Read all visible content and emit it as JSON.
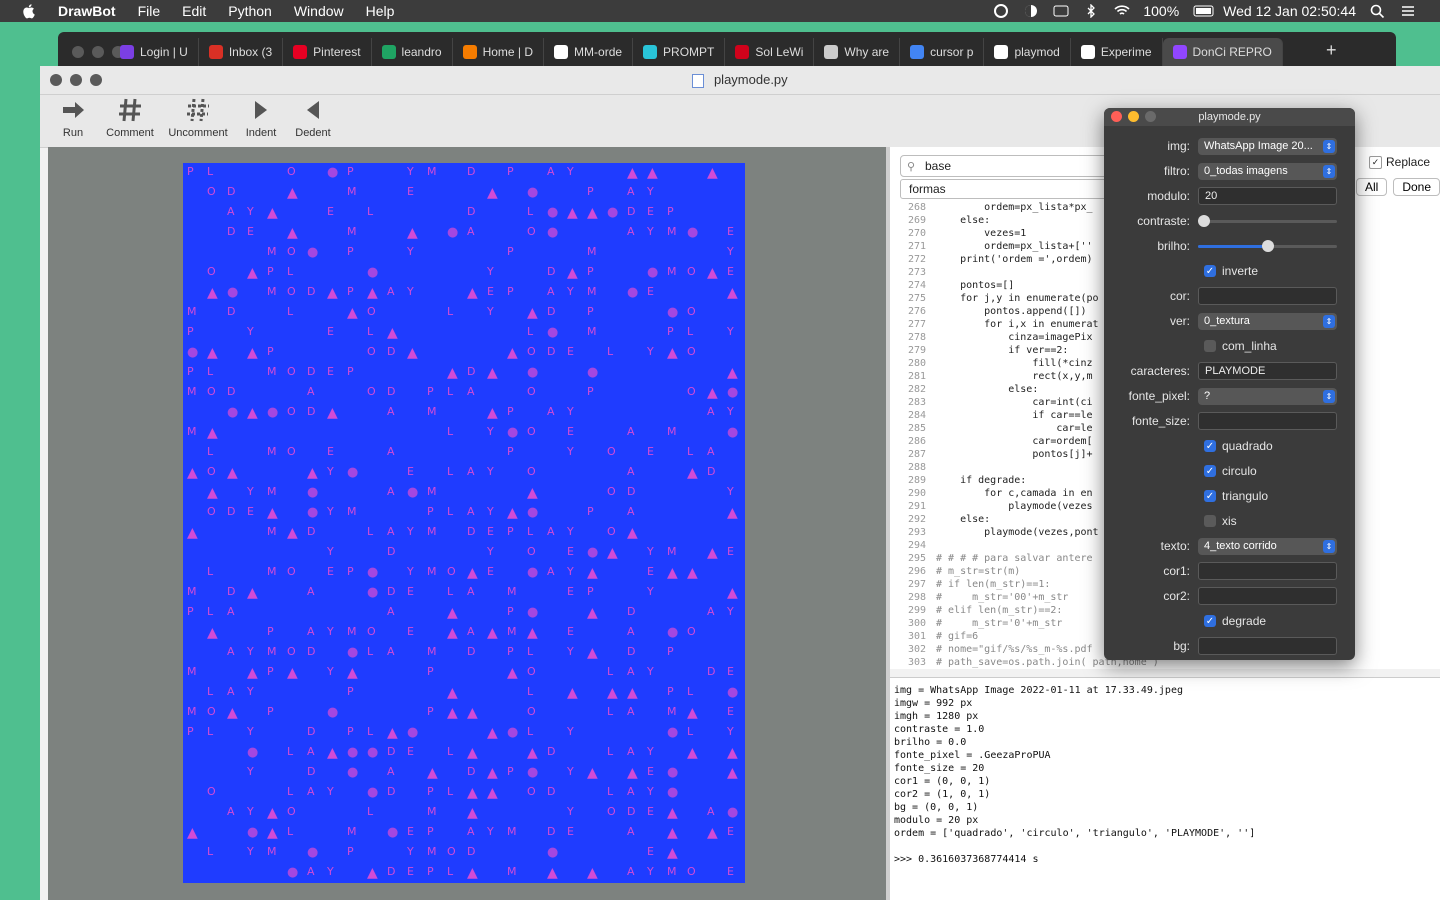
{
  "menubar": {
    "app": "DrawBot",
    "items": [
      "File",
      "Edit",
      "Python",
      "Window",
      "Help"
    ],
    "battery": "100%",
    "datetime": "Wed 12 Jan  02:50:44"
  },
  "browser_tabs": [
    {
      "label": "Login | U",
      "color": "#7b3fe4"
    },
    {
      "label": "Inbox (3",
      "color": "#d93025"
    },
    {
      "label": "Pinterest",
      "color": "#e60023"
    },
    {
      "label": "leandro",
      "color": "#1fa463"
    },
    {
      "label": "Home | D",
      "color": "#f57c00"
    },
    {
      "label": "MM-orde",
      "color": "#ffffff"
    },
    {
      "label": "PROMPT",
      "color": "#29c4d8"
    },
    {
      "label": "Sol LeWi",
      "color": "#d0021b"
    },
    {
      "label": "Why are",
      "color": "#cccccc"
    },
    {
      "label": "cursor p",
      "color": "#4285f4"
    },
    {
      "label": "playmod",
      "color": "#ffffff"
    },
    {
      "label": "Experime",
      "color": "#ffffff"
    },
    {
      "label": "DonCi REPRO",
      "color": "#9146ff"
    }
  ],
  "window": {
    "title": "playmode.py",
    "toolbar": [
      {
        "label": "Run",
        "icon": "run-arrow-icon"
      },
      {
        "label": "Comment",
        "icon": "hash-icon"
      },
      {
        "label": "Uncomment",
        "icon": "hash-dashed-icon"
      },
      {
        "label": "Indent",
        "icon": "indent-triangle-icon"
      },
      {
        "label": "Dedent",
        "icon": "dedent-triangle-icon"
      }
    ]
  },
  "find": {
    "search_value": "base",
    "replace_value": "formas",
    "replace_label": "Replace",
    "all_label": "All",
    "done_label": "Done"
  },
  "code_lines": [
    {
      "n": "268",
      "t": "        ordem=px_lista*px_"
    },
    {
      "n": "269",
      "t": "    else:"
    },
    {
      "n": "270",
      "t": "        vezes=1"
    },
    {
      "n": "271",
      "t": "        ordem=px_lista+[''"
    },
    {
      "n": "272",
      "t": "    print('ordem =',ordem)"
    },
    {
      "n": "273",
      "t": ""
    },
    {
      "n": "274",
      "t": "    pontos=[]"
    },
    {
      "n": "275",
      "t": "    for j,y in enumerate(po"
    },
    {
      "n": "276",
      "t": "        pontos.append([])"
    },
    {
      "n": "277",
      "t": "        for i,x in enumerat"
    },
    {
      "n": "278",
      "t": "            cinza=imagePix"
    },
    {
      "n": "279",
      "t": "            if ver==2:"
    },
    {
      "n": "280",
      "t": "                fill(*cinz"
    },
    {
      "n": "281",
      "t": "                rect(x,y,m"
    },
    {
      "n": "282",
      "t": "            else:"
    },
    {
      "n": "283",
      "t": "                car=int(ci"
    },
    {
      "n": "284",
      "t": "                if car==le"
    },
    {
      "n": "285",
      "t": "                    car=le"
    },
    {
      "n": "286",
      "t": "                car=ordem["
    },
    {
      "n": "287",
      "t": "                pontos[j]+"
    },
    {
      "n": "288",
      "t": ""
    },
    {
      "n": "289",
      "t": "    if degrade:"
    },
    {
      "n": "290",
      "t": "        for c,camada in en"
    },
    {
      "n": "291",
      "t": "            playmode(vezes"
    },
    {
      "n": "292",
      "t": "    else:"
    },
    {
      "n": "293",
      "t": "        playmode(vezes,pont"
    },
    {
      "n": "294",
      "t": ""
    },
    {
      "n": "295",
      "t": "# # # # para salvar antere"
    },
    {
      "n": "296",
      "t": "# m_str=str(m)"
    },
    {
      "n": "297",
      "t": "# if len(m_str)==1:"
    },
    {
      "n": "298",
      "t": "#     m_str='00'+m_str"
    },
    {
      "n": "299",
      "t": "# elif len(m_str)==2:"
    },
    {
      "n": "300",
      "t": "#     m_str='0'+m_str"
    },
    {
      "n": "301",
      "t": "# gif=6"
    },
    {
      "n": "302",
      "t": "# nome=\"gif/%s/%s_m-%s.pdf"
    },
    {
      "n": "303",
      "t": "# path_save=os.path.join( path,nome )"
    }
  ],
  "console": [
    "img = WhatsApp Image 2022-01-11 at 17.33.49.jpeg",
    "imgw = 992 px",
    "imgh = 1280 px",
    "contraste = 1.0",
    "brilho = 0.0",
    "fonte_pixel = .GeezaProPUA",
    "fonte_size = 20",
    "cor1 = (0, 0, 1)",
    "cor2 = (1, 0, 1)",
    "bg = (0, 0, 1)",
    "modulo = 20 px",
    "ordem = ['quadrado', 'circulo', 'triangulo', 'PLAYMODE', '']",
    "",
    ">>> 0.3616037368774414 s"
  ],
  "panel": {
    "title": "playmode.py",
    "img_label": "img:",
    "img_value": "WhatsApp Image 20...",
    "filtro_label": "filtro:",
    "filtro_value": "0_todas imagens",
    "modulo_label": "modulo:",
    "modulo_value": "20",
    "contraste_label": "contraste:",
    "contraste_level": 0.0,
    "brilho_label": "brilho:",
    "brilho_level": 0.5,
    "inverte_label": "inverte",
    "inverte_checked": true,
    "cor_label": "cor:",
    "ver_label": "ver:",
    "ver_value": "0_textura",
    "com_linha_label": "com_linha",
    "com_linha_checked": false,
    "caracteres_label": "caracteres:",
    "caracteres_value": "PLAYMODE",
    "fonte_pixel_label": "fonte_pixel:",
    "fonte_pixel_value": "?",
    "fonte_size_label": "fonte_size:",
    "quadrado_label": "quadrado",
    "circulo_label": "circulo",
    "triangulo_label": "triangulo",
    "xis_label": "xis",
    "texto_label": "texto:",
    "texto_value": "4_texto corrido",
    "cor1_label": "cor1:",
    "cor2_label": "cor2:",
    "degrade_label": "degrade",
    "bg_label": "bg:"
  },
  "artwork": {
    "bg_color": "#1f3cff",
    "fg_color": "#d24bd6",
    "text": "PLAYMODE"
  }
}
